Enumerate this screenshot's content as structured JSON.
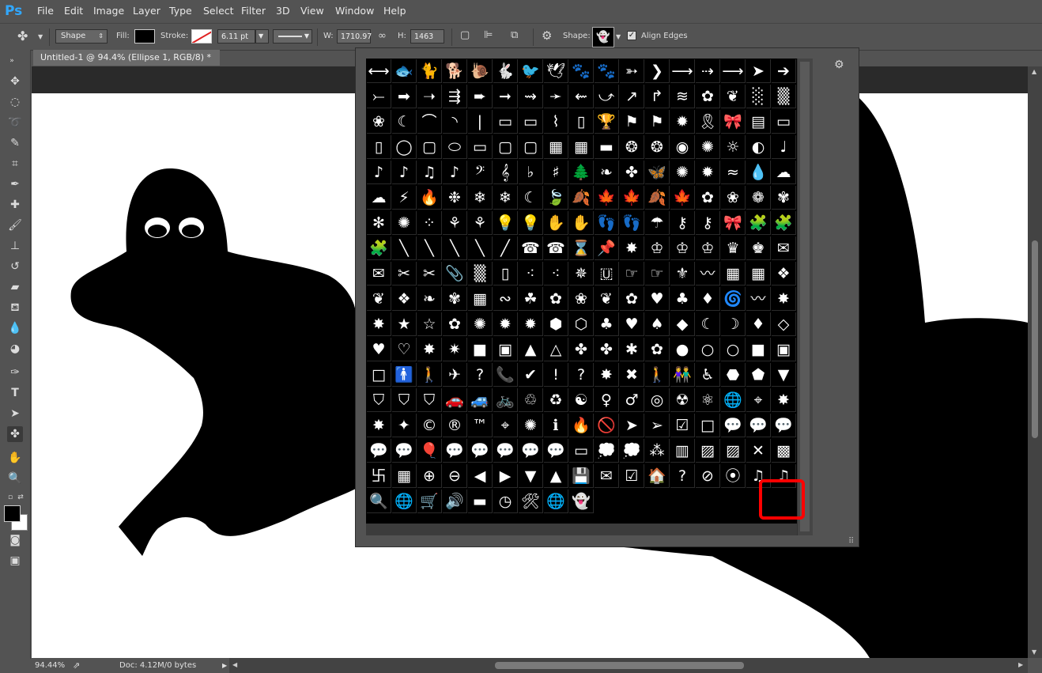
{
  "app": {
    "logo": "Ps"
  },
  "menu": [
    "File",
    "Edit",
    "Image",
    "Layer",
    "Type",
    "Select",
    "Filter",
    "3D",
    "View",
    "Window",
    "Help"
  ],
  "options": {
    "mode": "Shape",
    "fill_label": "Fill:",
    "stroke_label": "Stroke:",
    "stroke_width": "6.11 pt",
    "w_label": "W:",
    "w_value": "1710.97",
    "h_label": "H:",
    "h_value": "1463 px",
    "shape_label": "Shape:",
    "align_edges": "Align Edges"
  },
  "document": {
    "tab_title": "Untitled-1 @ 94.4% (Ellipse 1, RGB/8) *",
    "zoom": "94.44%",
    "doc_info": "Doc: 4.12M/0 bytes"
  },
  "shapes": [
    "⟷",
    "🐟",
    "🐈",
    "🐕",
    "🐌",
    "🐇",
    "🐦",
    "🕊",
    "🐾",
    "🐾",
    "➳",
    "❯",
    "⟶",
    "⇢",
    "⟶",
    "➤",
    "➔",
    "⤚",
    "➡",
    "➝",
    "⇶",
    "➨",
    "➞",
    "⇝",
    "➛",
    "⇜",
    "⤻",
    "↗",
    "↱",
    "≋",
    "✿",
    "❦",
    "░",
    "▒",
    "❀",
    "☾",
    "⌒",
    "◝",
    "❘",
    "▭",
    "▭",
    "⌇",
    "▯",
    "🏆",
    "⚑",
    "⚑",
    "✹",
    "🎗",
    "🎀",
    "▤",
    "▭",
    "▯",
    "◯",
    "▢",
    "⬭",
    "▭",
    "▢",
    "▢",
    "▦",
    "▦",
    "▬",
    "❂",
    "❂",
    "◉",
    "✺",
    "☼",
    "◐",
    "♩",
    "♪",
    "♪",
    "♫",
    "♪",
    "𝄢",
    "𝄞",
    "♭",
    "♯",
    "🌲",
    "❧",
    "✤",
    "🦋",
    "✺",
    "✹",
    "≈",
    "💧",
    "☁",
    "☁",
    "⚡",
    "🔥",
    "❉",
    "❄",
    "❄",
    "☾",
    "🍃",
    "🍂",
    "🍁",
    "🍁",
    "🍂",
    "🍁",
    "✿",
    "❀",
    "❁",
    "✾",
    "✻",
    "✺",
    "⁘",
    "⚘",
    "⚘",
    "💡",
    "💡",
    "✋",
    "✋",
    "👣",
    "👣",
    "☂",
    "⚷",
    "⚷",
    "🎀",
    "🧩",
    "🧩",
    "🧩",
    "╲",
    "╲",
    "╲",
    "╲",
    "╱",
    "☎",
    "☎",
    "⌛",
    "📌",
    "✸",
    "♔",
    "♔",
    "♔",
    "♛",
    "♚",
    "✉",
    "✉",
    "✂",
    "✂",
    "📎",
    "▒",
    "▯",
    "⁖",
    "⁖",
    "✵",
    "🇺",
    "☞",
    "☞",
    "⚜",
    "〰",
    "▦",
    "▦",
    "❖",
    "❦",
    "❖",
    "❧",
    "✾",
    "▦",
    "∾",
    "☘",
    "✿",
    "❀",
    "❦",
    "✿",
    "♥",
    "♣",
    "♦",
    "🌀",
    "〰",
    "✸",
    "✸",
    "★",
    "☆",
    "✿",
    "✺",
    "✹",
    "✹",
    "⬢",
    "⬡",
    "♣",
    "♥",
    "♠",
    "◆",
    "☾",
    "☽",
    "♦",
    "◇",
    "♥",
    "♡",
    "✸",
    "✷",
    "■",
    "▣",
    "▲",
    "△",
    "✤",
    "✤",
    "✱",
    "✿",
    "●",
    "○",
    "○",
    "■",
    "▣",
    "□",
    "🚹",
    "🚶",
    "✈",
    "?",
    "📞",
    "✔",
    "!",
    "?",
    "✸",
    "✖",
    "🚶",
    "👫",
    "♿",
    "⬣",
    "⬟",
    "▼",
    "⛉",
    "⛉",
    "⛉",
    "🚗",
    "🚙",
    "🚲",
    "♲",
    "♻",
    "☯",
    "♀",
    "♂",
    "◎",
    "☢",
    "⚛",
    "🌐",
    "⌖",
    "✸",
    "✸",
    "✦",
    "©",
    "®",
    "™",
    "⌖",
    "✺",
    "ℹ",
    "🔥",
    "🚫",
    "➤",
    "➢",
    "☑",
    "□",
    "💬",
    "💬",
    "💬",
    "💬",
    "💬",
    "🎈",
    "💬",
    "💬",
    "💬",
    "💬",
    "💬",
    "▭",
    "💭",
    "💭",
    "⁂",
    "▥",
    "▨",
    "▨",
    "✕",
    "▩",
    "卐",
    "▦",
    "⊕",
    "⊖",
    "◀",
    "▶",
    "▼",
    "▲",
    "💾",
    "✉",
    "☑",
    "🏠",
    "?",
    "⊘",
    "⦿",
    "♫",
    "♫",
    "🔍",
    "🌐",
    "🛒",
    "🔊",
    "▬",
    "◷",
    "🛠",
    "🌐",
    "👻"
  ]
}
